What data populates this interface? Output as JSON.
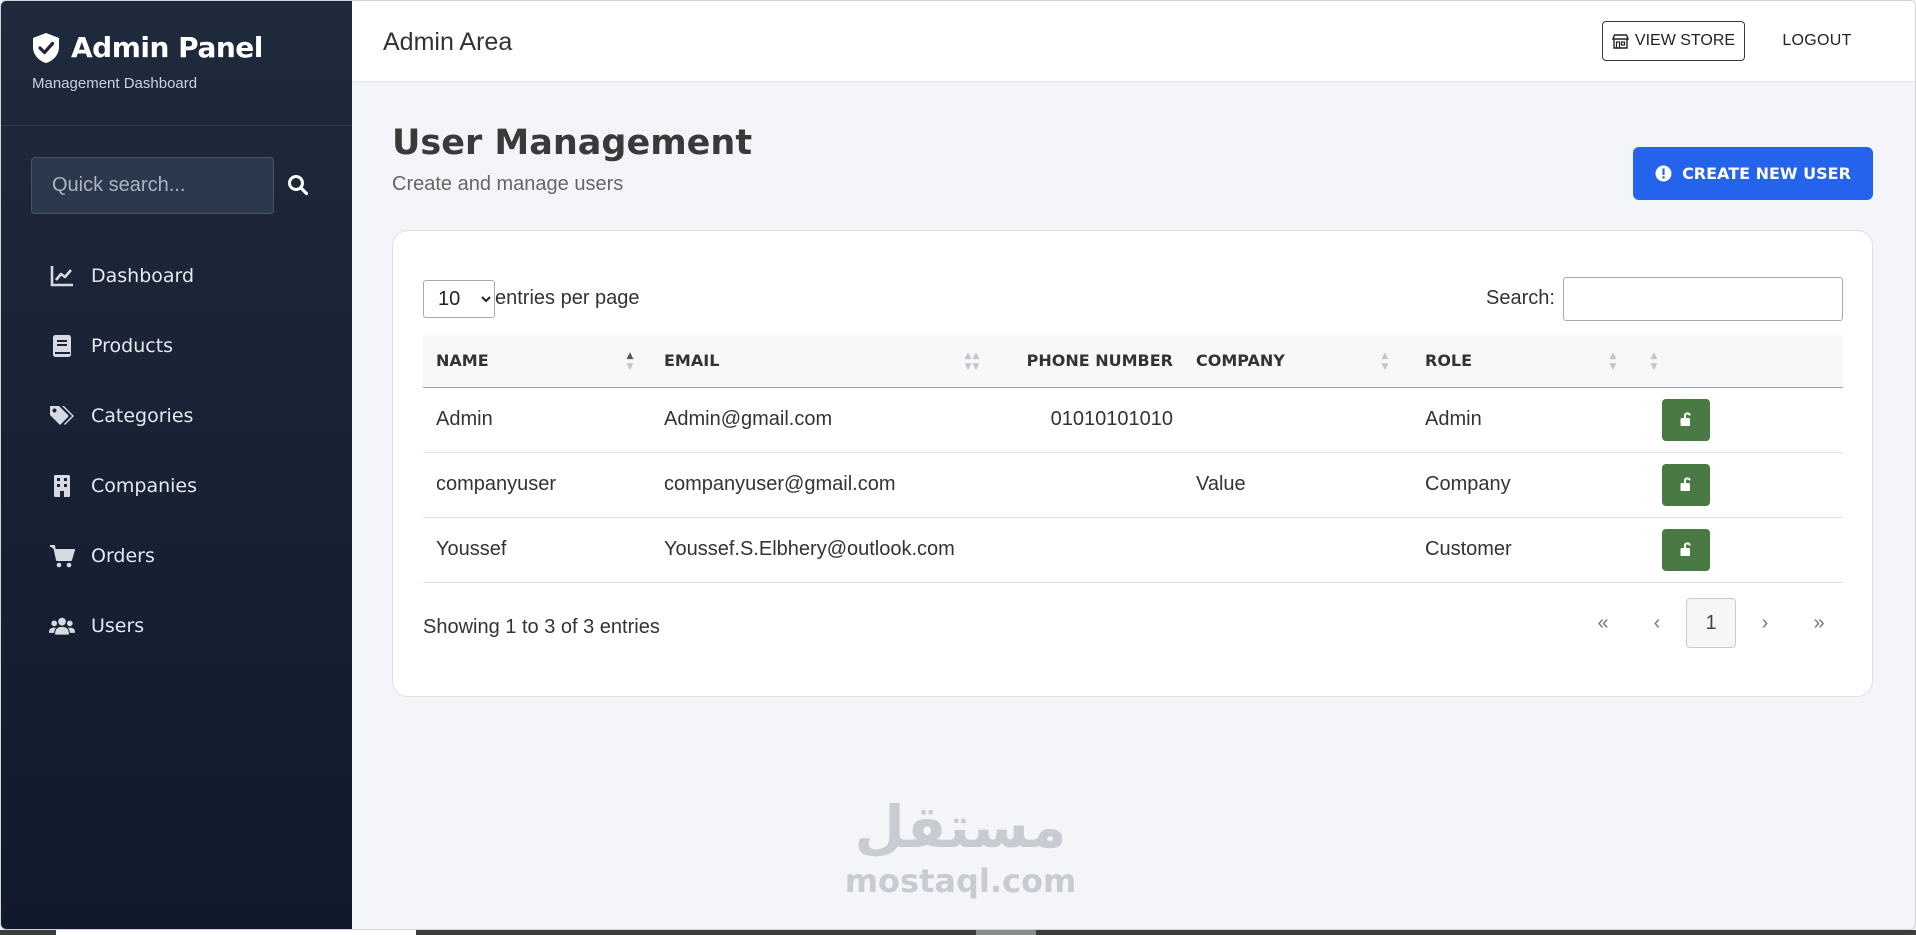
{
  "sidebar": {
    "brand_title": "Admin Panel",
    "brand_subtitle": "Management Dashboard",
    "search_placeholder": "Quick search...",
    "items": [
      {
        "label": "Dashboard",
        "icon": "chart-line-icon"
      },
      {
        "label": "Products",
        "icon": "book-icon"
      },
      {
        "label": "Categories",
        "icon": "tags-icon"
      },
      {
        "label": "Companies",
        "icon": "building-icon"
      },
      {
        "label": "Orders",
        "icon": "cart-icon"
      },
      {
        "label": "Users",
        "icon": "users-icon"
      }
    ]
  },
  "topbar": {
    "title": "Admin Area",
    "view_store_label": "VIEW STORE",
    "logout_label": "LOGOUT"
  },
  "main": {
    "title": "User Management",
    "subtitle": "Create and manage users",
    "create_button_label": "CREATE NEW USER"
  },
  "table": {
    "length_value": "10",
    "length_options": [
      "10"
    ],
    "length_label": "entries per page",
    "search_label": "Search:",
    "search_value": "",
    "columns": [
      "NAME",
      "EMAIL",
      "PHONE NUMBER",
      "COMPANY",
      "ROLE"
    ],
    "rows": [
      {
        "name": "Admin",
        "email": "Admin@gmail.com",
        "phone": "01010101010",
        "company": "",
        "role": "Admin"
      },
      {
        "name": "companyuser",
        "email": "companyuser@gmail.com",
        "phone": "",
        "company": "Value",
        "role": "Company"
      },
      {
        "name": "Youssef",
        "email": "Youssef.S.Elbhery@outlook.com",
        "phone": "",
        "company": "",
        "role": "Customer"
      }
    ],
    "info": "Showing 1 to 3 of 3 entries",
    "pagination": {
      "first": "«",
      "prev": "‹",
      "current": "1",
      "next": "›",
      "last": "»"
    }
  },
  "watermark": {
    "arabic": "مستقل",
    "latin": "mostaql.com"
  },
  "colors": {
    "sidebar": "#1a2436",
    "primary": "#2463eb",
    "lock_button": "#4a7a43"
  }
}
